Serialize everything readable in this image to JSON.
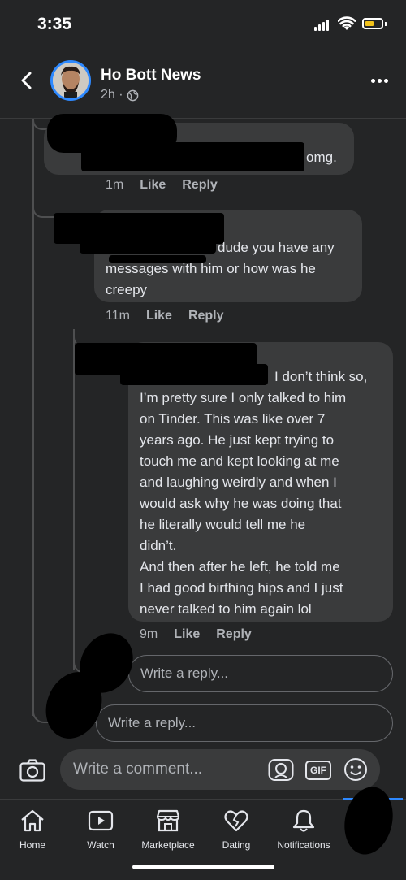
{
  "status_bar": {
    "time": "3:35"
  },
  "header": {
    "page_name": "Ho Bott News",
    "time_ago": "2h ·"
  },
  "comments": [
    {
      "text": "omg.",
      "time": "1m",
      "like": "Like",
      "reply": "Reply"
    },
    {
      "text_line1": "dude you have any",
      "text_line2": "messages with him or how was he",
      "text_line3": "creepy",
      "time": "11m",
      "like": "Like",
      "reply": "Reply"
    },
    {
      "lines": [
        "I don’t think so,",
        "I’m pretty sure I only talked to him",
        "on Tinder. This was like over 7",
        "years ago. He just kept trying to",
        "touch me and kept looking at me",
        "and laughing weirdly and when I",
        "would ask why he was doing that",
        "he literally would tell me he",
        "didn’t.",
        "And then after he left, he told me",
        "I had good birthing hips and I just",
        "never talked to him again lol"
      ],
      "time": "9m",
      "like": "Like",
      "reply": "Reply"
    }
  ],
  "reply_inputs": {
    "inner_placeholder": "Write a reply...",
    "outer_placeholder": "Write a reply..."
  },
  "composer": {
    "placeholder": "Write a comment...",
    "gif_label": "GIF"
  },
  "tabs": [
    {
      "label": "Home",
      "icon": "home-icon"
    },
    {
      "label": "Watch",
      "icon": "watch-icon"
    },
    {
      "label": "Marketplace",
      "icon": "marketplace-icon"
    },
    {
      "label": "Dating",
      "icon": "dating-icon"
    },
    {
      "label": "Notifications",
      "icon": "bell-icon"
    },
    {
      "label": "",
      "icon": "menu-avatar-icon"
    }
  ],
  "colors": {
    "background": "#242526",
    "bubble": "#3a3b3c",
    "accent": "#2e89ff"
  }
}
